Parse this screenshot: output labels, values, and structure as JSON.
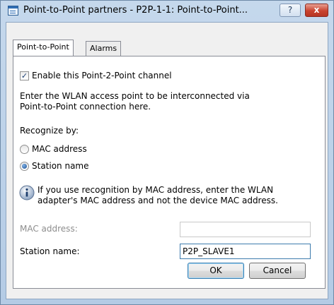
{
  "window": {
    "title": "Point-to-Point partners - P2P-1-1: Point-to-Point...",
    "help_label": "?",
    "close_label": "x"
  },
  "tabs": [
    {
      "label": "Point-to-Point",
      "active": true
    },
    {
      "label": "Alarms",
      "active": false
    }
  ],
  "form": {
    "enable_checkbox": {
      "label": "Enable this Point-2-Point channel",
      "checked": true
    },
    "intro_line1": "Enter the WLAN access point to be interconnected via",
    "intro_line2": "Point-to-Point connection here.",
    "recognize_label": "Recognize by:",
    "recognize_options": [
      {
        "label": "MAC address",
        "selected": false
      },
      {
        "label": "Station name",
        "selected": true
      }
    ],
    "info_line1": "If you use recognition by MAC address, enter the WLAN",
    "info_line2": "adapter's MAC address and not the device MAC address.",
    "mac_address": {
      "label": "MAC address:",
      "value": "",
      "disabled": true
    },
    "station_name": {
      "label": "Station name:",
      "value": "P2P_SLAVE1"
    }
  },
  "buttons": {
    "ok": "OK",
    "cancel": "Cancel"
  },
  "icons": {
    "app": "window-icon",
    "info": "info-icon",
    "help": "help-icon",
    "close": "close-icon"
  },
  "colors": {
    "titlebar": "#c5d8ec",
    "close": "#c9432f",
    "dialog_bg": "#f0f0f0"
  }
}
